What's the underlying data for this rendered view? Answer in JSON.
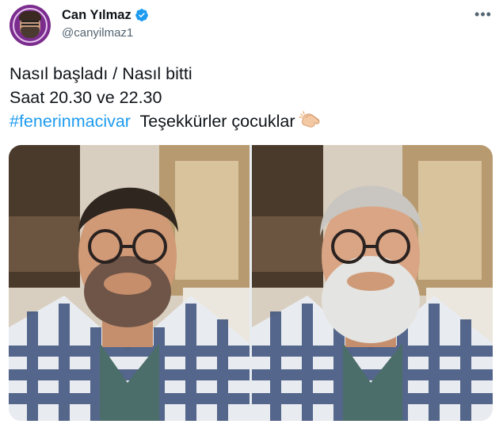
{
  "author": {
    "display_name": "Can Yılmaz",
    "handle": "@canyilmaz1",
    "verified_icon": "verified-badge-icon",
    "avatar_icon": "avatar-portrait"
  },
  "tweet": {
    "lines": [
      "Nasıl başladı / Nasıl bitti",
      "Saat 20.30 ve  22.30"
    ],
    "hashtag": "#fenerinmacivar",
    "thanks": "Teşekkürler çocuklar",
    "emoji_icon": "clapping-hands-icon"
  },
  "media": {
    "photos": [
      {
        "name": "before-photo",
        "icon": "man-dark-hair-beard"
      },
      {
        "name": "after-photo",
        "icon": "man-gray-hair-white-beard"
      }
    ]
  },
  "colors": {
    "link": "#1d9bf0",
    "verified": "#1d9bf0",
    "secondary_text": "#536471",
    "avatar_bg": "#7b2d8e"
  }
}
